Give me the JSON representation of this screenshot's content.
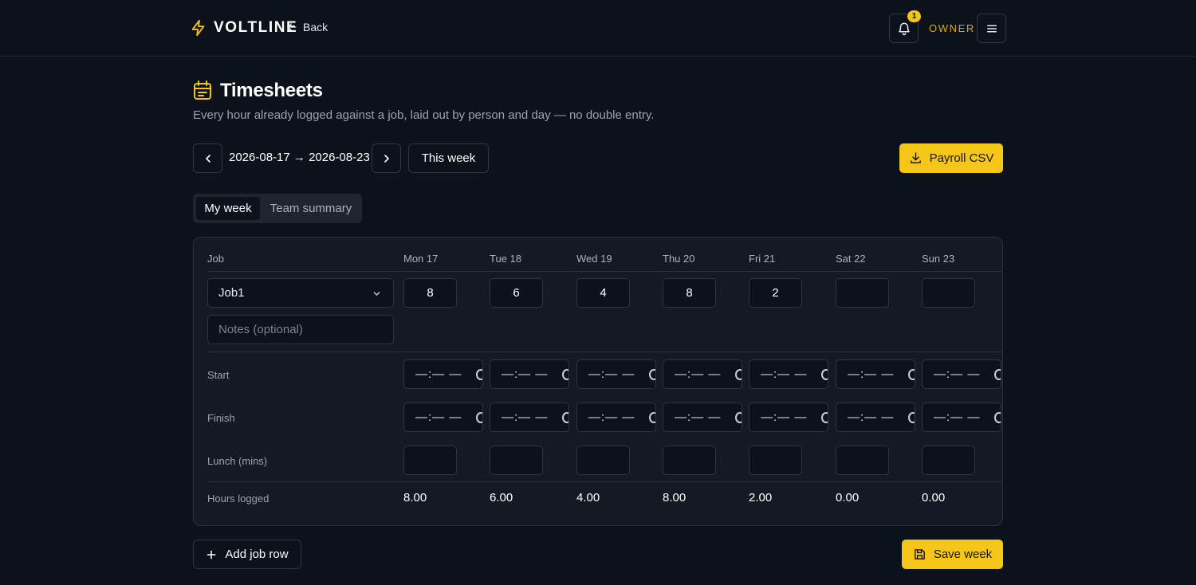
{
  "header": {
    "brand": "VOLTLINE",
    "back_label": "Back",
    "notification_count": "1",
    "role": "OWNER"
  },
  "page": {
    "title": "Timesheets",
    "subtitle": "Every hour already logged against a job, laid out by person and day — no double entry."
  },
  "week_nav": {
    "range": "2026-08-17 → 2026-08-23",
    "this_week_label": "This week",
    "export_label": "Payroll CSV"
  },
  "tabs": [
    {
      "label": "My week",
      "active": true
    },
    {
      "label": "Team summary",
      "active": false
    }
  ],
  "table": {
    "job_header": "Job",
    "days": [
      "Mon 17",
      "Tue 18",
      "Wed 19",
      "Thu 20",
      "Fri 21",
      "Sat 22",
      "Sun 23"
    ],
    "job_value": "Job1",
    "notes_placeholder": "Notes (optional)",
    "hours": [
      "8",
      "6",
      "4",
      "8",
      "2",
      "",
      ""
    ],
    "start_label": "Start",
    "finish_label": "Finish",
    "lunch_label": "Lunch (mins)",
    "time_placeholder": "—:— —",
    "totals_label": "Hours logged",
    "totals": [
      "8.00",
      "6.00",
      "4.00",
      "8.00",
      "2.00",
      "0.00",
      "0.00"
    ]
  },
  "footer": {
    "add_row_label": "Add job row",
    "save_label": "Save week"
  },
  "colors": {
    "accent": "#f5c518",
    "background": "#0c121b",
    "card": "#141a23"
  }
}
